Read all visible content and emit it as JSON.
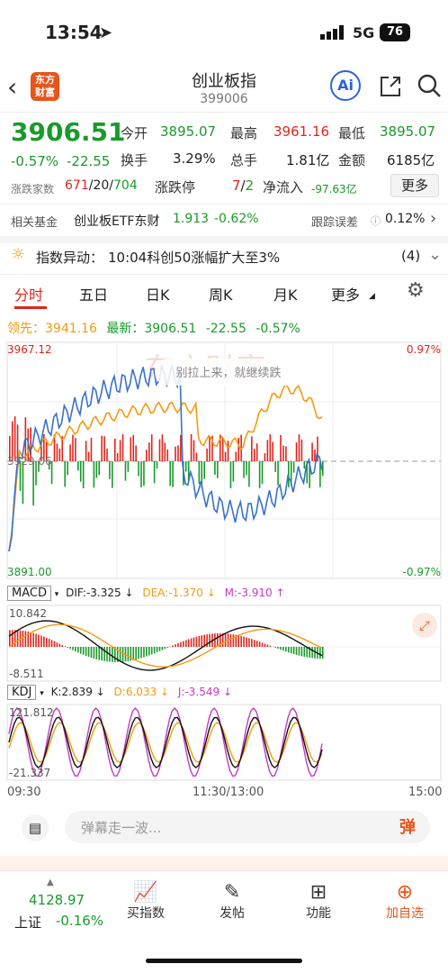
{
  "status": {
    "time": "13:54",
    "network": "5G",
    "battery": "76"
  },
  "header": {
    "logo_text": "东方财富",
    "title": "创业板指",
    "code": "399006",
    "ai_label": "Ai"
  },
  "quote": {
    "price": "3906.51",
    "change_pct": "-0.57%",
    "change": "-22.55",
    "open_label": "今开",
    "open": "3895.07",
    "high_label": "最高",
    "high": "3961.16",
    "low_label": "最低",
    "low": "3895.07",
    "turnover_label": "换手",
    "turnover": "3.29%",
    "volume_label": "总手",
    "volume": "1.81亿",
    "amount_label": "金额",
    "amount": "6185亿",
    "updown_label": "涨跌家数",
    "up": "671",
    "flat": "20",
    "down": "704",
    "limit_label": "涨跌停",
    "limit_up": "7",
    "limit_down": "2",
    "netflow_label": "净流入",
    "netflow": "-97.63亿",
    "more_label": "更多"
  },
  "fund": {
    "label": "相关基金",
    "name": "创业板ETF东财",
    "price": "1.913",
    "chg": "-0.62%",
    "track_label": "跟踪误差",
    "track": "0.12%"
  },
  "alert": {
    "label": "指数异动：",
    "text": "10:04科创50涨幅扩大至3%",
    "count": "(4)"
  },
  "tabs": [
    "分时",
    "五日",
    "日K",
    "周K",
    "月K",
    "更多"
  ],
  "info": {
    "lead_label": "领先：",
    "lead": "3941.16",
    "latest_label": "最新：",
    "latest": "3906.51",
    "chg": "-22.55",
    "pct": "-0.57%"
  },
  "chart": {
    "y_top": "3967.12",
    "y_top_pct": "0.97%",
    "y_mid": "3929.06",
    "y_bottom": "3891.00",
    "y_bottom_pct": "-0.97%",
    "watermark": "东方财富",
    "bubble": "别拉上来，就继续跌"
  },
  "macd": {
    "name": "MACD",
    "dif": "DIF:-3.325 ↓",
    "dea": "DEA:-1.370 ↓",
    "m": "M:-3.910 ↑",
    "top": "10.842",
    "bottom": "-8.511"
  },
  "kdj": {
    "name": "KDJ",
    "k": "K:2.839 ↓",
    "d": "D:6.033 ↓",
    "j": "J:-3.549 ↓",
    "top": "121.812",
    "bottom": "-21.337"
  },
  "xaxis": {
    "start": "09:30",
    "mid": "11:30/13:00",
    "end": "15:00"
  },
  "danmu": {
    "placeholder": "弹幕走一波...",
    "btn": "弹"
  },
  "nav": {
    "index_name": "上证",
    "index_price": "4128.97",
    "index_chg": "-0.16%",
    "items": [
      "买指数",
      "发帖",
      "功能",
      "加自选"
    ]
  }
}
